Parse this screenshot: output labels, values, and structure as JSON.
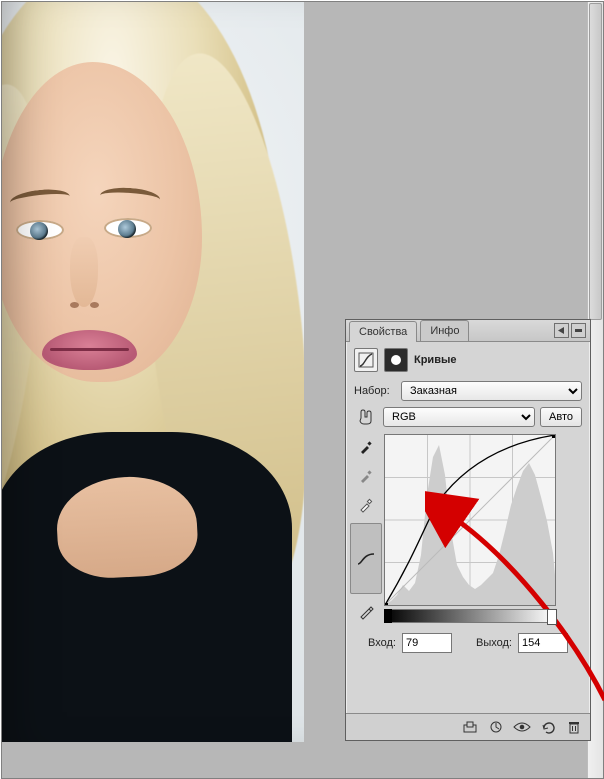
{
  "tabs": {
    "properties": "Свойства",
    "info": "Инфо"
  },
  "header": {
    "title": "Кривые"
  },
  "preset": {
    "label": "Набор:",
    "value": "Заказная"
  },
  "channel": {
    "value": "RGB",
    "auto_label": "Авто"
  },
  "io": {
    "input_label": "Вход:",
    "input_value": "79",
    "output_label": "Выход:",
    "output_value": "154"
  },
  "icons": {
    "menu": "panel-menu-icon",
    "collapse": "collapse-icon",
    "curves": "curves-icon",
    "mask": "mask-icon",
    "finger": "finger-tool-icon",
    "eyedropper_black": "eyedropper-black-icon",
    "eyedropper_gray": "eyedropper-gray-icon",
    "eyedropper_white": "eyedropper-white-icon",
    "curve_tool": "curve-tool-icon",
    "pencil": "pencil-tool-icon",
    "clip": "clip-to-layer-icon",
    "prev_state": "view-previous-state-icon",
    "reset": "reset-icon",
    "visibility": "visibility-icon",
    "trash": "trash-icon"
  },
  "chart_data": {
    "type": "line",
    "title": "Кривые",
    "xlabel": "Вход",
    "ylabel": "Выход",
    "xlim": [
      0,
      255
    ],
    "ylim": [
      0,
      255
    ],
    "series": [
      {
        "name": "RGB",
        "points": [
          [
            0,
            0
          ],
          [
            79,
            154
          ],
          [
            255,
            255
          ]
        ]
      }
    ],
    "selected_point": [
      79,
      154
    ],
    "histogram_peaks_x": [
      20,
      35,
      55,
      80,
      95,
      120,
      150,
      175,
      200,
      220,
      240
    ],
    "histogram_peaks_y": [
      8,
      20,
      35,
      140,
      60,
      25,
      18,
      40,
      60,
      120,
      90
    ]
  }
}
